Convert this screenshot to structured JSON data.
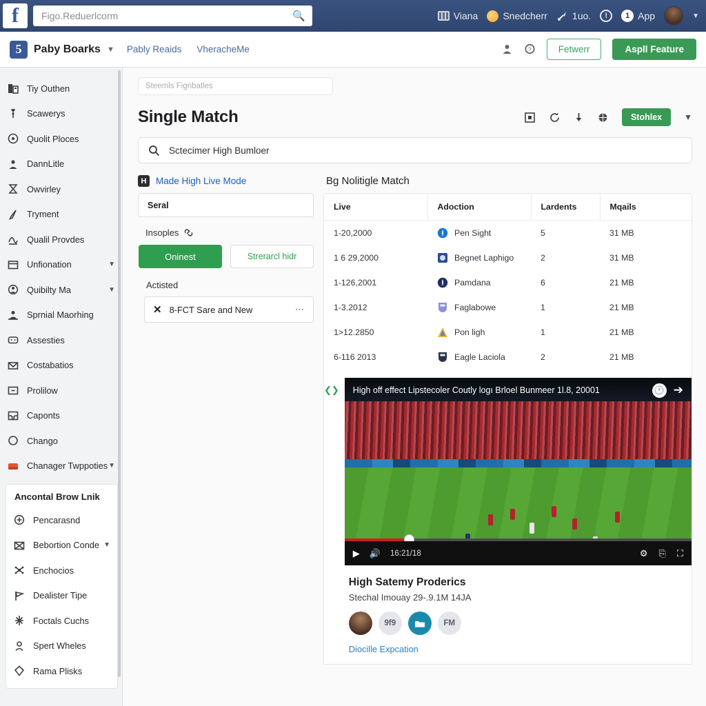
{
  "topbar": {
    "logo_glyph": "f",
    "search": {
      "value": "Figo.Reduerlcorm",
      "icon": "search-icon"
    },
    "items": [
      {
        "icon": "photos-icon",
        "label": "Viana"
      },
      {
        "icon": "emoji-face-icon",
        "label": "Snedcherr"
      },
      {
        "icon": "rocket-icon",
        "label": "1uo."
      },
      {
        "icon": "clock-alert-icon",
        "label": ""
      },
      {
        "icon": "notification-badge",
        "label": "1"
      },
      {
        "icon": "",
        "label": "App"
      },
      {
        "icon": "avatar-icon",
        "label": ""
      },
      {
        "icon": "chevron-down-icon",
        "label": ""
      }
    ]
  },
  "navbar": {
    "brand_glyph": "5",
    "brand": "Paby Boarks",
    "links": [
      "Pably Reaids",
      "VheracheMe"
    ],
    "icon_upload": "upload-icon",
    "icon_help": "help-icon",
    "secondary_button": "Fetwerr",
    "primary_button": "Aspll Feature"
  },
  "sidebar": {
    "items": [
      {
        "label": "Tiy Outhen",
        "icon": "building-icon",
        "caret": false
      },
      {
        "label": "Scawerys",
        "icon": "pin-icon",
        "caret": false
      },
      {
        "label": "Quolit Ploces",
        "icon": "target-icon",
        "caret": false
      },
      {
        "label": "DannLitle",
        "icon": "user-badge-icon",
        "caret": false
      },
      {
        "label": "Owvirley",
        "icon": "hourglass-icon",
        "caret": false
      },
      {
        "label": "Tryment",
        "icon": "pen-icon",
        "caret": false
      },
      {
        "label": "Qualil Provdes",
        "icon": "signature-icon",
        "caret": false
      },
      {
        "label": "Unfionation",
        "icon": "window-icon",
        "caret": true
      },
      {
        "label": "Quibilty Ma",
        "icon": "user-circle-icon",
        "caret": true
      },
      {
        "label": "Sprnial Maorhing",
        "icon": "group-icon",
        "caret": false
      },
      {
        "label": "Assesties",
        "icon": "wallet-icon",
        "caret": false
      },
      {
        "label": "Costabatios",
        "icon": "envelope-icon",
        "caret": false
      },
      {
        "label": "Prolilow",
        "icon": "minus-box-icon",
        "caret": false
      },
      {
        "label": "Caponts",
        "icon": "inbox-icon",
        "caret": false
      },
      {
        "label": "Chango",
        "icon": "circle-icon",
        "caret": false
      },
      {
        "label": "Chanager Twppoties",
        "icon": "card-red-icon",
        "caret": true
      }
    ],
    "card": {
      "title": "Ancontal Brow Lnik",
      "items": [
        {
          "label": "Pencarasnd",
          "icon": "plus-circle-icon",
          "caret": false
        },
        {
          "label": "Bebortion Conde",
          "icon": "envelope-x-icon",
          "caret": true
        },
        {
          "label": "Enchocios",
          "icon": "share-nodes-icon",
          "caret": false
        },
        {
          "label": "Dealister Tipe",
          "icon": "flag-icon",
          "caret": false
        },
        {
          "label": "Foctals Cuchs",
          "icon": "sparkle-icon",
          "caret": false
        },
        {
          "label": "Spert Wheles",
          "icon": "user-icon",
          "caret": false
        },
        {
          "label": "Rama Plisks",
          "icon": "diamond-icon",
          "caret": false
        }
      ]
    }
  },
  "main": {
    "breadcrumb_placeholder": "Steemls Fignbatles",
    "breadcrumb_value": "",
    "title": "Single Match",
    "tools": [
      {
        "icon": "image-box-icon"
      },
      {
        "icon": "refresh-icon"
      },
      {
        "icon": "download-icon"
      },
      {
        "icon": "globe-icon"
      }
    ],
    "chip_button": "Stohlex",
    "chip_caret": "chevron-down-icon",
    "search": {
      "icon": "search-icon",
      "value": "Sctecimer High Bumloer",
      "placeholder": "Sctecimer High Bumloer"
    }
  },
  "left_panel": {
    "live_mode": {
      "icon": "live-mode-icon",
      "glyph": "H",
      "label": "Made High Live Mode"
    },
    "serial": "Seral",
    "insoples": {
      "label": "Insoples",
      "icon": "link-icon"
    },
    "button_primary": "Oninest",
    "button_secondary": "Strerarcl hidr",
    "actisted_label": "Actisted",
    "actisted_item": {
      "close_icon": "close-icon",
      "label": "8-FCT Sare and New",
      "menu_icon": "more-dots-icon"
    }
  },
  "table": {
    "title": "Bg Nolitigle Match",
    "columns": [
      "Live",
      "Adoction",
      "Lardents",
      "Mqails"
    ],
    "rows": [
      {
        "live": "1-20,2000",
        "app": "Pen Sight",
        "color": "#1877d2",
        "shape": "circle",
        "lardents": "5",
        "mqails": "31 MB"
      },
      {
        "live": "1 6 29,2000",
        "app": "Begnet Laphigo",
        "color": "#2d4b8e",
        "shape": "square",
        "lardents": "2",
        "mqails": "31 MB"
      },
      {
        "live": "1-126,2001",
        "app": "Pamdana",
        "color": "#1f2f63",
        "shape": "circle",
        "lardents": "6",
        "mqails": "21 MB"
      },
      {
        "live": "1-3.2012",
        "app": "Faglabowe",
        "color": "#8d8ed6",
        "shape": "shield",
        "lardents": "1",
        "mqails": "21 MB"
      },
      {
        "live": "1>12.2850",
        "app": "Pon ligh",
        "color": "#e8b33c",
        "shape": "triangle",
        "lardents": "1",
        "mqails": "21 MB"
      },
      {
        "live": "6-116 2013",
        "app": "Eagle Laciola",
        "color": "#2b3246",
        "shape": "shield",
        "lardents": "2",
        "mqails": "21 MB"
      }
    ]
  },
  "video": {
    "side_icon": "code-icon",
    "overlay_title": "High off effect Lipstecoler Coutly logı Brloel Bunmeer 1l.8, 20001",
    "overlay_clock_icon": "clock-icon",
    "overlay_arrow_icon": "arrow-right-icon",
    "controls": {
      "play_icon": "play-icon",
      "volume_icon": "volume-icon",
      "time": "16:21/18",
      "settings_icon": "gear-icon",
      "miniplayer_icon": "miniplayer-icon",
      "fullscreen_icon": "fullscreen-icon"
    },
    "meta": {
      "title": "High Satemy Proderics",
      "subtitle": "Stechal Imouay 29-.9.1M 14JA",
      "avatars": [
        {
          "type": "photo",
          "label": ""
        },
        {
          "type": "text",
          "label": "9f9"
        },
        {
          "type": "teal",
          "label": ""
        },
        {
          "type": "text",
          "label": "FM"
        }
      ],
      "link": "Diocille Expcation"
    }
  },
  "colors": {
    "header_blue": "#33497a",
    "accent_green": "#3a9a55",
    "link_blue": "#2a7fc0",
    "sidebar_bg": "#f2f3f5"
  }
}
